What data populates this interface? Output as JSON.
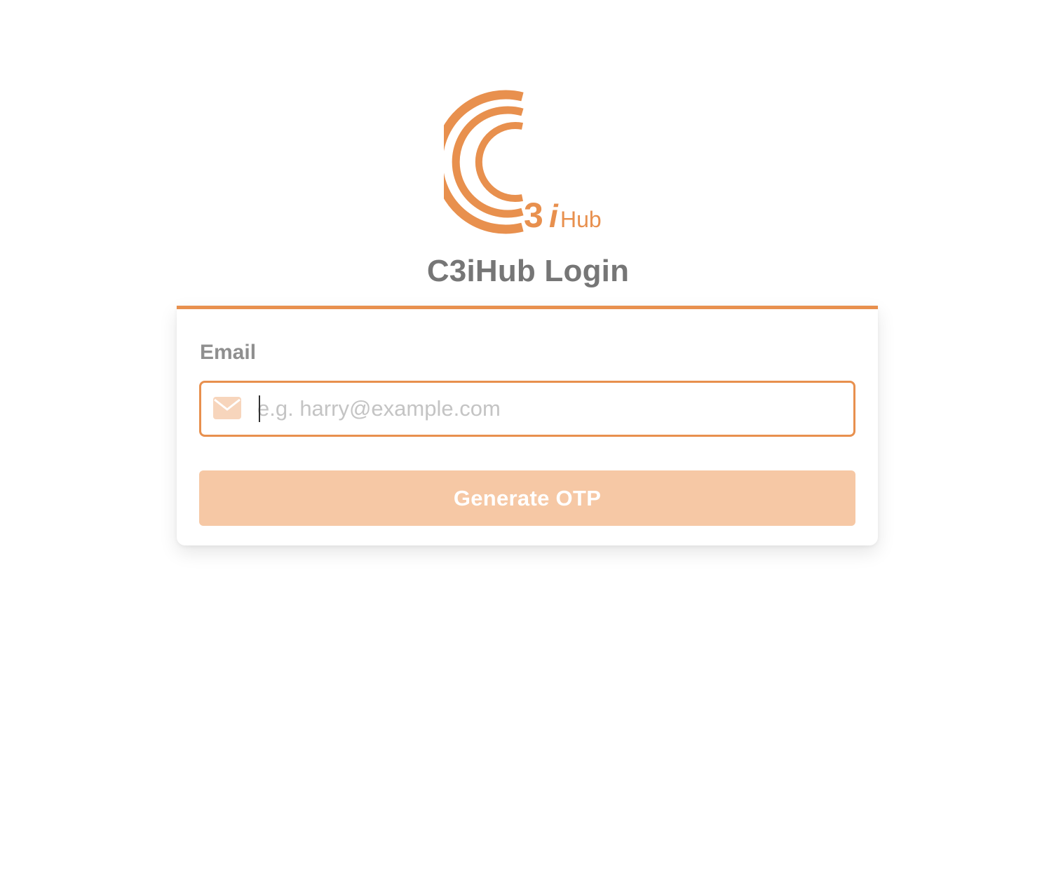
{
  "brand": {
    "logo_text_3": "3",
    "logo_text_i": "i",
    "logo_text_hub": "Hub",
    "accent_color": "#e8904e"
  },
  "page": {
    "title": "C3iHub Login"
  },
  "form": {
    "email_label": "Email",
    "email_value": "",
    "email_placeholder": "e.g. harry@example.com",
    "email_icon": "envelope-icon",
    "submit_label": "Generate OTP",
    "submit_color": "#f6c8a5"
  }
}
